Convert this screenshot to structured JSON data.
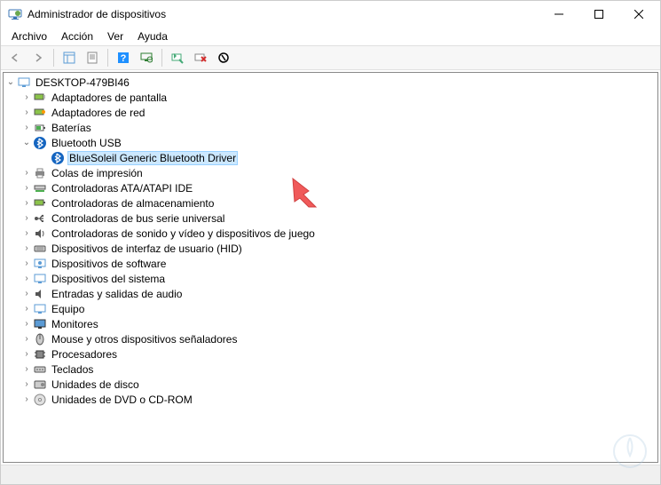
{
  "title": "Administrador de dispositivos",
  "menu": {
    "archivo": "Archivo",
    "accion": "Acción",
    "ver": "Ver",
    "ayuda": "Ayuda"
  },
  "root": "DESKTOP-479BI46",
  "nodes": {
    "adaptadores_pantalla": "Adaptadores de pantalla",
    "adaptadores_red": "Adaptadores de red",
    "baterias": "Baterías",
    "bluetooth_usb": "Bluetooth USB",
    "bluesoleil": "BlueSoleil Generic Bluetooth Driver",
    "colas_impresion": "Colas de impresión",
    "controladoras_ata": "Controladoras ATA/ATAPI IDE",
    "controladoras_almacenamiento": "Controladoras de almacenamiento",
    "controladoras_usb": "Controladoras de bus serie universal",
    "controladoras_sonido": "Controladoras de sonido y vídeo y dispositivos de juego",
    "dispositivos_hid": "Dispositivos de interfaz de usuario (HID)",
    "dispositivos_software": "Dispositivos de software",
    "dispositivos_sistema": "Dispositivos del sistema",
    "entradas_salidas_audio": "Entradas y salidas de audio",
    "equipo": "Equipo",
    "monitores": "Monitores",
    "mouse": "Mouse y otros dispositivos señaladores",
    "procesadores": "Procesadores",
    "teclados": "Teclados",
    "unidades_disco": "Unidades de disco",
    "unidades_dvd": "Unidades de DVD o CD-ROM"
  },
  "colors": {
    "selection_bg": "#cce8ff",
    "selection_border": "#99d1ff",
    "pointer": "#f05a5a"
  }
}
